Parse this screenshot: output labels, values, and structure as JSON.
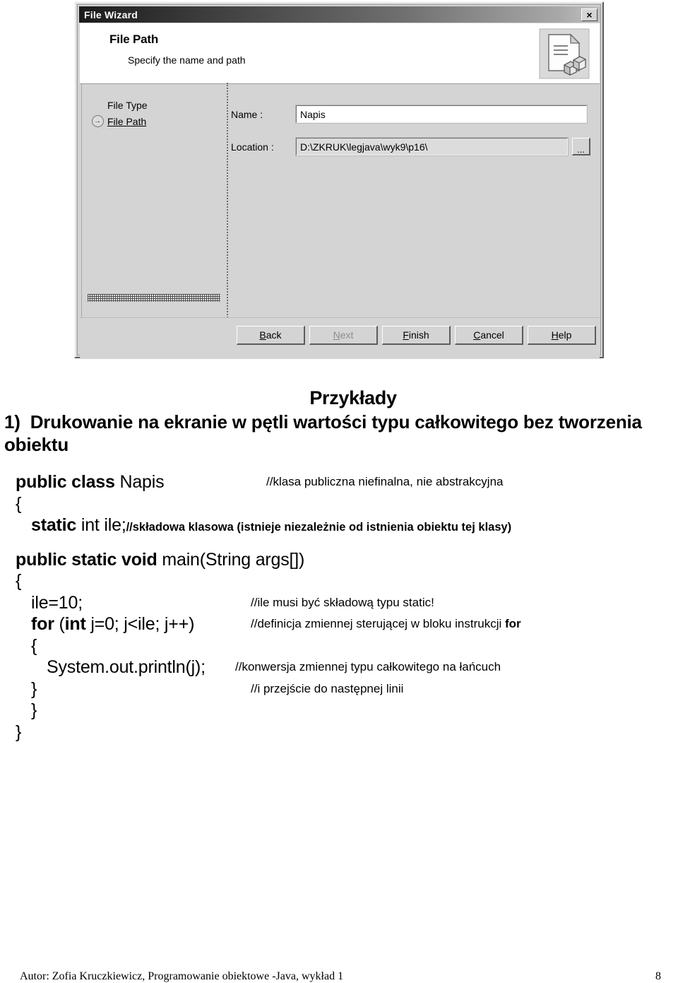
{
  "dialog": {
    "title": "File Wizard",
    "close_label": "×",
    "header": {
      "title": "File Path",
      "subtitle": "Specify the name and path",
      "icon": "document-with-blocks-icon"
    },
    "steps": [
      {
        "label": "File Type",
        "current": false,
        "marker": ""
      },
      {
        "label": "File Path",
        "current": true,
        "marker": "→"
      }
    ],
    "fields": [
      {
        "name_label": "Name :",
        "value": "Napis",
        "readonly": false
      },
      {
        "name_label": "Location :",
        "value": "D:\\ZKRUK\\legjava\\wyk9\\p16\\",
        "readonly": true,
        "browse_label": "..."
      }
    ],
    "buttons": [
      {
        "label": "Back",
        "mnemonic": "B",
        "disabled": false
      },
      {
        "label": "Next",
        "mnemonic": "N",
        "disabled": true
      },
      {
        "label": "Finish",
        "mnemonic": "F",
        "disabled": false
      },
      {
        "label": "Cancel",
        "mnemonic": "C",
        "disabled": false
      },
      {
        "label": "Help",
        "mnemonic": "H",
        "disabled": false
      }
    ]
  },
  "slide": {
    "title": "Przykłady",
    "heading_number": "1)",
    "heading_text": "Drukowanie na ekranie w pętli wartości typu całkowitego bez tworzenia obiektu",
    "code": {
      "l1_kw": "public class ",
      "l1_rest": "Napis",
      "l1_comment": "//klasa publiczna niefinalna, nie abstrakcyjna",
      "l2": "{",
      "l3_kw": "static ",
      "l3_rest": "int ile;",
      "l3_comment": "//składowa klasowa (istnieje niezależnie od istnienia obiektu tej klasy)",
      "l4_kw": "public static void ",
      "l4_rest": "main(String args[])",
      "l5": "{",
      "l6": "ile=10;",
      "l6_comment": "//ile musi być składową typu static!",
      "l7_kw1": "for ",
      "l7_p1": "(",
      "l7_kw2": "int ",
      "l7_rest": "j=0; j<ile; j++)",
      "l7_comment_a": "//definicja zmiennej sterującej w bloku instrukcji ",
      "l7_comment_b": "for",
      "l8": "{",
      "l9": "System.out.println(j);",
      "l9_comment": "//konwersja zmiennej typu całkowitego na łańcuch",
      "l10": "}",
      "l10_comment": "//i przejście do następnej linii",
      "l11": "}",
      "l12": "}"
    }
  },
  "footer": {
    "text": "Autor:  Zofia Kruczkiewicz, Programowanie obiektowe -Java, wykład 1",
    "page": "8"
  }
}
